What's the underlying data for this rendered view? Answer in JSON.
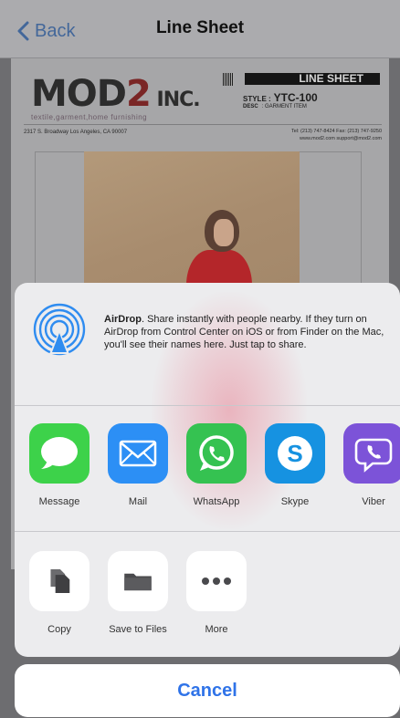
{
  "nav": {
    "back_label": "Back",
    "title": "Line Sheet"
  },
  "document": {
    "logo_main": "MOD",
    "logo_two": "2",
    "logo_inc": "INC.",
    "tagline": "textile,garment,home furnishing",
    "sheet_label": "LINE SHEET",
    "style_label": "STYLE :",
    "style_value": "YTC-100",
    "desc_label": "DESC",
    "desc_value": ": GARMENT ITEM",
    "address": "2317 S. Broadway  Los Angeles, CA 90007",
    "contact_line1": "Tel: (213) 747-8424   Fax: (213) 747-9250",
    "contact_line2": "www.mod2.com  support@mod2.com"
  },
  "share": {
    "airdrop_title": "AirDrop",
    "airdrop_desc": ". Share instantly with people nearby. If they turn on AirDrop from Control Center on iOS or from Finder on the Mac, you'll see their names here. Just tap to share.",
    "apps": [
      {
        "label": "Message",
        "icon": "message-icon",
        "color": "#3dd24a"
      },
      {
        "label": "Mail",
        "icon": "mail-icon",
        "color": "#2c8ff5"
      },
      {
        "label": "WhatsApp",
        "icon": "whatsapp-icon",
        "color": "#35c251"
      },
      {
        "label": "Skype",
        "icon": "skype-icon",
        "color": "#1692e1"
      },
      {
        "label": "Viber",
        "icon": "viber-icon",
        "color": "#7c53d8"
      }
    ],
    "actions": [
      {
        "label": "Copy",
        "icon": "copy-icon"
      },
      {
        "label": "Save to Files",
        "icon": "folder-icon"
      },
      {
        "label": "More",
        "icon": "more-icon"
      }
    ],
    "cancel_label": "Cancel"
  },
  "colors": {
    "accent": "#2f73e8",
    "nav_back": "#43679a"
  }
}
